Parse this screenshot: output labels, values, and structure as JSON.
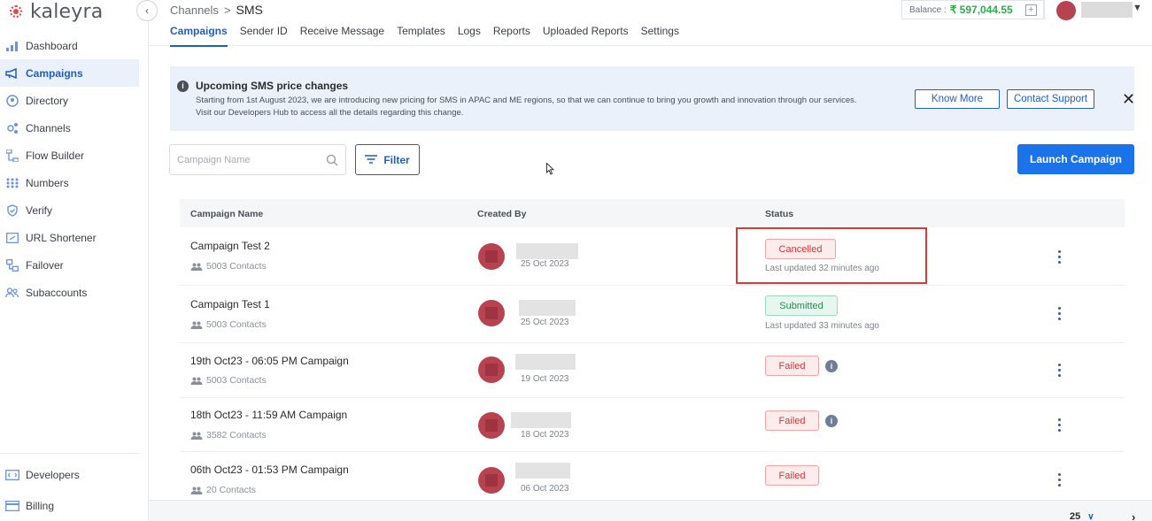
{
  "brand": {
    "name": "kaleyra",
    "accent": "#e2483d"
  },
  "sidebar": {
    "items": [
      {
        "label": "Dashboard",
        "icon": "bar-chart-icon",
        "active": false
      },
      {
        "label": "Campaigns",
        "icon": "megaphone-icon",
        "active": true
      },
      {
        "label": "Directory",
        "icon": "contact-icon",
        "active": false
      },
      {
        "label": "Channels",
        "icon": "channels-icon",
        "active": false
      },
      {
        "label": "Flow Builder",
        "icon": "flow-icon",
        "active": false
      },
      {
        "label": "Numbers",
        "icon": "dialpad-icon",
        "active": false
      },
      {
        "label": "Verify",
        "icon": "shield-icon",
        "active": false
      },
      {
        "label": "URL Shortener",
        "icon": "link-icon",
        "active": false
      },
      {
        "label": "Failover",
        "icon": "failover-icon",
        "active": false
      },
      {
        "label": "Subaccounts",
        "icon": "users-icon",
        "active": false
      }
    ],
    "bottom_items": [
      {
        "label": "Developers",
        "icon": "code-icon"
      },
      {
        "label": "Billing",
        "icon": "card-icon"
      }
    ]
  },
  "header": {
    "breadcrumb": {
      "parent": "Channels",
      "separator": ">",
      "current": "SMS"
    },
    "tabs": [
      "Campaigns",
      "Sender ID",
      "Receive Message",
      "Templates",
      "Logs",
      "Reports",
      "Uploaded Reports",
      "Settings"
    ],
    "active_tab": "Campaigns",
    "balance": {
      "label": "Balance :",
      "amount": "₹ 597,044.55",
      "color": "#2fa84f"
    }
  },
  "notice": {
    "title": "Upcoming SMS price changes",
    "line1": "Starting from 1st August 2023, we are introducing new pricing for SMS in APAC and ME regions, so that we can continue to bring you growth and innovation through our services.",
    "line2": "Visit our Developers Hub to access all the details regarding this change.",
    "know_more": "Know More",
    "contact_support": "Contact Support",
    "close": "✕"
  },
  "toolbar": {
    "search_placeholder": "Campaign Name",
    "filter_label": "Filter",
    "launch_label": "Launch Campaign"
  },
  "table": {
    "columns": [
      "Campaign Name",
      "Created By",
      "Status"
    ],
    "rows": [
      {
        "name": "Campaign Test 2",
        "contacts": "5003 Contacts",
        "date": "25 Oct 2023",
        "status": "Cancelled",
        "status_type": "cancelled",
        "note": "Last updated 32 minutes ago",
        "info": false
      },
      {
        "name": "Campaign Test 1",
        "contacts": "5003 Contacts",
        "date": "25 Oct 2023",
        "status": "Submitted",
        "status_type": "submitted",
        "note": "Last updated 33 minutes ago",
        "info": false
      },
      {
        "name": "19th Oct23 - 06:05 PM Campaign",
        "contacts": "5003 Contacts",
        "date": "19 Oct 2023",
        "status": "Failed",
        "status_type": "failed",
        "note": "",
        "info": true
      },
      {
        "name": "18th Oct23 - 11:59 AM Campaign",
        "contacts": "3582 Contacts",
        "date": "18 Oct 2023",
        "status": "Failed",
        "status_type": "failed",
        "note": "",
        "info": true
      },
      {
        "name": "06th Oct23 - 01:53 PM Campaign",
        "contacts": "20 Contacts",
        "date": "06 Oct 2023",
        "status": "Failed",
        "status_type": "failed",
        "note": "",
        "info": false
      }
    ]
  },
  "pagination": {
    "page_size": "25"
  },
  "colors": {
    "primary": "#1a73e8",
    "cancelled": "#d6333a",
    "submitted": "#2e8a55",
    "highlight": "#d63c3c"
  }
}
